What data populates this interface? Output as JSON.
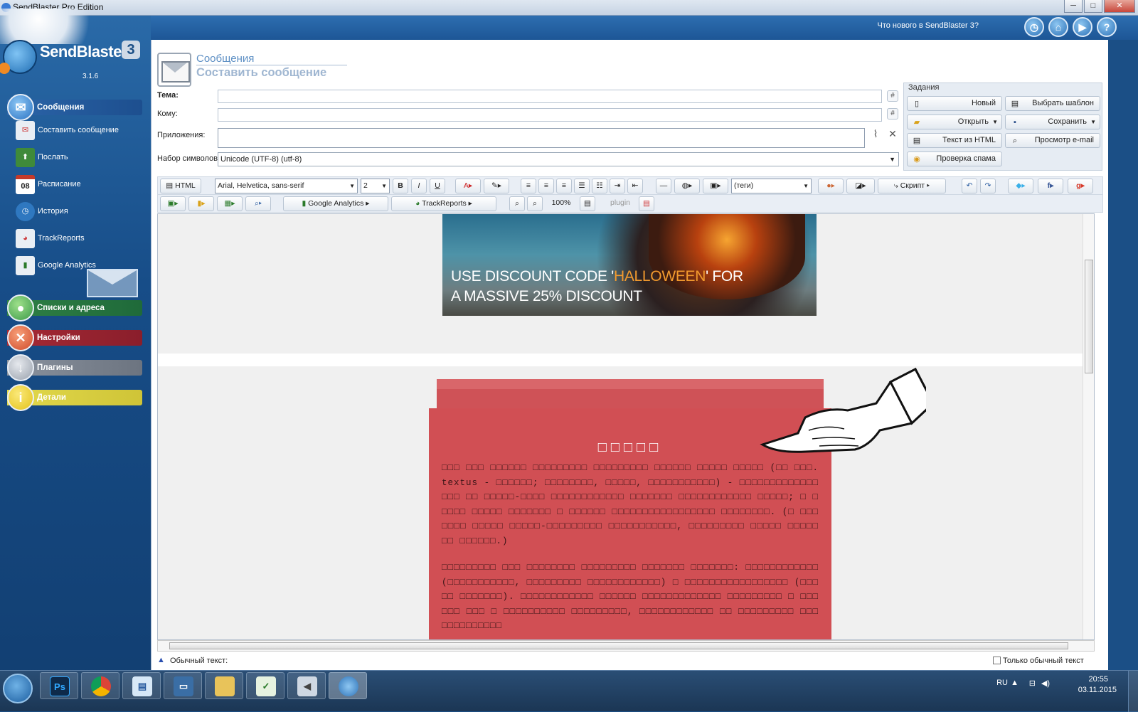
{
  "window": {
    "title": "SendBlaster Pro Edition",
    "minimize": "─",
    "maximize": "□",
    "close": "✕"
  },
  "logo": {
    "name": "SendBlaster",
    "version_badge": "3",
    "version": "3.1.6"
  },
  "topbar": {
    "whats_new": "Что нового в SendBlaster 3?"
  },
  "sidebar": {
    "sections": [
      {
        "label": "Сообщения",
        "color": "#1d4f8f",
        "ball": "#2c74c4"
      },
      {
        "label": "Списки и адреса",
        "color": "#1f6a3a",
        "ball": "#3c9a4a"
      },
      {
        "label": "Настройки",
        "color": "#8a1e2b",
        "ball": "#d04a2a"
      },
      {
        "label": "Плагины",
        "color": "#6c7480",
        "ball": "#9aa2ad"
      },
      {
        "label": "Детали",
        "color": "#cfc437",
        "ball": "#e3c21a"
      }
    ],
    "items": [
      {
        "label": "Составить сообщение"
      },
      {
        "label": "Послать"
      },
      {
        "label": "Расписание",
        "badge": "08"
      },
      {
        "label": "История"
      },
      {
        "label": "TrackReports"
      },
      {
        "label": "Google Analytics"
      }
    ]
  },
  "header": {
    "section": "Сообщения",
    "title": "Составить сообщение"
  },
  "form": {
    "subject_label": "Тема:",
    "to_label": "Кому:",
    "attachments_label": "Приложения:",
    "charset_label": "Набор символов:",
    "charset_value": "Unicode (UTF-8)    (utf-8)",
    "hash": "#"
  },
  "tasks": {
    "label": "Задания",
    "buttons": [
      "Новый",
      "Выбрать шаблон",
      "Открыть",
      "Сохранить",
      "Текст из HTML",
      "Просмотр e-mail",
      "Проверка спама"
    ]
  },
  "toolbar1": {
    "html": "HTML",
    "font": "Arial, Helvetica, sans-serif",
    "size": "2",
    "bold": "B",
    "italic": "I",
    "underline": "U",
    "tags": "(теги)",
    "script": "Скрипт"
  },
  "toolbar2": {
    "google_analytics": "Google Analytics",
    "trackreports": "TrackReports",
    "zoom": "100%",
    "plugin": "plugin"
  },
  "editor": {
    "banner_line1_pre": "USE DISCOUNT CODE '",
    "banner_line1_hl": "HALLOWEEN",
    "banner_line1_post": "' FOR",
    "banner_line2": "A MASSIVE 25% DISCOUNT",
    "card_title": "□□□□□",
    "para1": "□□□ □□□ □□□□□□ □□□□□□□□□ □□□□□□□□□ □□□□□□ □□□□□ □□□□□ (□□ □□□. textus - □□□□□□; □□□□□□□□, □□□□□, □□□□□□□□□□□) - □□□□□□□□□□□□□□□□ □□ □□□□□-□□□□ □□□□□□□□□□□□ □□□□□□□ □□□□□□□□□□□□ □□□□□; □ □□□□□ □□□□□ □□□□□□□ □ □□□□□□ □□□□□□□□□□□□□□□□□ □□□□□□□□. (□ □□□□□□□ □□□□□ □□□□□-□□□□□□□□□ □□□□□□□□□□□, □□□□□□□□□ □□□□□ □□□□□ □□ □□□□□□.)",
    "para2": "□□□□□□□□□ □□□ □□□□□□□□ □□□□□□□□□ □□□□□□□ □□□□□□□: □□□□□□□□□□□□ (□□□□□□□□□□□, □□□□□□□□□ □□□□□□□□□□□□) □ □□□□□□□□□□□□□□□□□ (□□□□□ □□□□□□□). □□□□□□□□□□□□ □□□□□□ □□□□□□□□□□□□□ □□□□□□□□□ □ □□□□□□ □□□ □ □□□□□□□□□□ □□□□□□□□□, □□□□□□□□□□□□ □□ □□□□□□□□□ □□□ □□□□□□□□□□"
  },
  "status": {
    "plain_text_label": "Обычный текст:",
    "only_plain": "Только обычный текст"
  },
  "taskbar": {
    "lang": "RU",
    "time": "20:55",
    "date": "03.11.2015"
  }
}
